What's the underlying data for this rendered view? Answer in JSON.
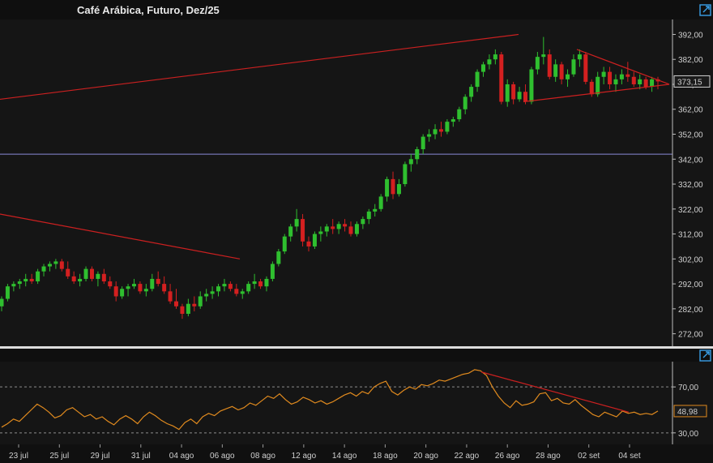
{
  "header": {
    "title": "Café Arábica, Futuro, Dez/25"
  },
  "colors": {
    "background": "#151515",
    "up": "#2fbf2f",
    "down": "#d42020",
    "trendline": "#cc2020",
    "hline": "#8a8ad8",
    "rsi": "#e08a1e",
    "label_box_rsi": "#e08a1e",
    "accent_icon": "#3aa0e8"
  },
  "chart_data": [
    {
      "type": "candlestick",
      "title": "Café Arábica, Futuro, Dez/25",
      "ylim": [
        267,
        398
      ],
      "yticks": [
        "392,00",
        "382,00",
        "372,00",
        "362,00",
        "352,00",
        "342,00",
        "332,00",
        "322,00",
        "312,00",
        "302,00",
        "292,00",
        "282,00",
        "272,00"
      ],
      "last_price_label": "373,15",
      "horizontal_line": 344.0,
      "x_labels": [
        "23 jul",
        "25 jul",
        "29 jul",
        "31 jul",
        "04 ago",
        "06 ago",
        "08 ago",
        "12 ago",
        "14 ago",
        "18 ago",
        "20 ago",
        "22 ago",
        "26 ago",
        "28 ago",
        "02 set",
        "04 set"
      ],
      "candles": [
        [
          283,
          287,
          281,
          286
        ],
        [
          286,
          292,
          285,
          291
        ],
        [
          291,
          293,
          289,
          292
        ],
        [
          292,
          294,
          290,
          293
        ],
        [
          293,
          296,
          291,
          294
        ],
        [
          294,
          296,
          292,
          293
        ],
        [
          293,
          298,
          292,
          297
        ],
        [
          297,
          300,
          295,
          299
        ],
        [
          299,
          301,
          297,
          300
        ],
        [
          300,
          302,
          298,
          301
        ],
        [
          301,
          302,
          297,
          298
        ],
        [
          298,
          301,
          294,
          295
        ],
        [
          295,
          297,
          292,
          293
        ],
        [
          293,
          296,
          291,
          294
        ],
        [
          294,
          299,
          293,
          298
        ],
        [
          298,
          299,
          293,
          294
        ],
        [
          294,
          297,
          291,
          296
        ],
        [
          296,
          298,
          292,
          293
        ],
        [
          293,
          295,
          290,
          291
        ],
        [
          291,
          293,
          285,
          287
        ],
        [
          287,
          291,
          286,
          290
        ],
        [
          290,
          292,
          287,
          291
        ],
        [
          291,
          294,
          290,
          292
        ],
        [
          292,
          293,
          288,
          289
        ],
        [
          289,
          292,
          287,
          290
        ],
        [
          290,
          296,
          289,
          294
        ],
        [
          294,
          297,
          291,
          292
        ],
        [
          292,
          295,
          288,
          289
        ],
        [
          289,
          292,
          284,
          285
        ],
        [
          285,
          290,
          282,
          283
        ],
        [
          283,
          284,
          278,
          280
        ],
        [
          280,
          286,
          279,
          284
        ],
        [
          284,
          287,
          281,
          283
        ],
        [
          283,
          289,
          282,
          287
        ],
        [
          287,
          290,
          285,
          288
        ],
        [
          288,
          291,
          286,
          289
        ],
        [
          289,
          292,
          287,
          291
        ],
        [
          291,
          294,
          289,
          292
        ],
        [
          292,
          293,
          289,
          290
        ],
        [
          290,
          292,
          287,
          288
        ],
        [
          288,
          290,
          286,
          289
        ],
        [
          289,
          293,
          288,
          292
        ],
        [
          292,
          296,
          290,
          293
        ],
        [
          293,
          294,
          290,
          291
        ],
        [
          291,
          295,
          289,
          294
        ],
        [
          294,
          301,
          293,
          300
        ],
        [
          300,
          306,
          299,
          305
        ],
        [
          305,
          312,
          304,
          311
        ],
        [
          311,
          316,
          309,
          315
        ],
        [
          315,
          322,
          313,
          318
        ],
        [
          318,
          320,
          307,
          309
        ],
        [
          309,
          311,
          305,
          307
        ],
        [
          307,
          313,
          306,
          312
        ],
        [
          312,
          315,
          309,
          313
        ],
        [
          313,
          316,
          311,
          315
        ],
        [
          315,
          318,
          312,
          314
        ],
        [
          314,
          317,
          312,
          316
        ],
        [
          316,
          318,
          313,
          315
        ],
        [
          315,
          317,
          311,
          312
        ],
        [
          312,
          317,
          311,
          316
        ],
        [
          316,
          319,
          314,
          318
        ],
        [
          318,
          322,
          316,
          321
        ],
        [
          321,
          324,
          319,
          322
        ],
        [
          322,
          328,
          321,
          327
        ],
        [
          327,
          335,
          325,
          334
        ],
        [
          334,
          337,
          326,
          328
        ],
        [
          328,
          334,
          327,
          332
        ],
        [
          332,
          341,
          331,
          340
        ],
        [
          340,
          344,
          337,
          342
        ],
        [
          342,
          347,
          340,
          346
        ],
        [
          346,
          352,
          344,
          351
        ],
        [
          351,
          354,
          349,
          352
        ],
        [
          352,
          356,
          350,
          354
        ],
        [
          354,
          357,
          351,
          353
        ],
        [
          353,
          358,
          352,
          357
        ],
        [
          357,
          359,
          355,
          358
        ],
        [
          358,
          363,
          357,
          362
        ],
        [
          362,
          368,
          360,
          367
        ],
        [
          367,
          372,
          365,
          371
        ],
        [
          371,
          378,
          369,
          377
        ],
        [
          377,
          381,
          375,
          380
        ],
        [
          380,
          384,
          378,
          382
        ],
        [
          382,
          386,
          380,
          384
        ],
        [
          384,
          385,
          364,
          365
        ],
        [
          365,
          374,
          363,
          372
        ],
        [
          372,
          373,
          364,
          366
        ],
        [
          366,
          371,
          365,
          369
        ],
        [
          369,
          372,
          364,
          365
        ],
        [
          365,
          379,
          364,
          378
        ],
        [
          378,
          385,
          376,
          383
        ],
        [
          383,
          391,
          380,
          384
        ],
        [
          384,
          386,
          374,
          375
        ],
        [
          375,
          382,
          373,
          380
        ],
        [
          380,
          381,
          372,
          374
        ],
        [
          374,
          378,
          371,
          376
        ],
        [
          376,
          384,
          375,
          382
        ],
        [
          382,
          386,
          379,
          384
        ],
        [
          384,
          385,
          372,
          373
        ],
        [
          373,
          374,
          367,
          368
        ],
        [
          368,
          377,
          367,
          375
        ],
        [
          375,
          379,
          372,
          377
        ],
        [
          377,
          379,
          370,
          372
        ],
        [
          372,
          376,
          369,
          374
        ],
        [
          374,
          378,
          372,
          376
        ],
        [
          376,
          381,
          373,
          375
        ],
        [
          375,
          377,
          371,
          372
        ],
        [
          372,
          376,
          370,
          374
        ],
        [
          374,
          375,
          370,
          371
        ],
        [
          371,
          375,
          369,
          374
        ],
        [
          374,
          375,
          370,
          373.15
        ]
      ],
      "trendlines": [
        [
          0,
          366,
          640,
          392
        ],
        [
          0,
          320,
          296,
          302
        ],
        [
          646,
          365,
          826,
          372
        ],
        [
          712,
          386,
          826,
          372
        ]
      ]
    },
    {
      "type": "line",
      "title": "",
      "ylim": [
        20,
        92
      ],
      "yticks": [
        "70,00",
        "30,00"
      ],
      "reference_lines": [
        70,
        30
      ],
      "last_value_label": "48,98",
      "values": [
        35,
        38,
        42,
        40,
        45,
        50,
        55,
        52,
        48,
        43,
        45,
        50,
        52,
        48,
        44,
        46,
        42,
        44,
        40,
        37,
        42,
        45,
        42,
        38,
        44,
        48,
        45,
        41,
        38,
        36,
        33,
        39,
        42,
        38,
        44,
        47,
        45,
        49,
        51,
        53,
        50,
        52,
        56,
        54,
        58,
        62,
        60,
        64,
        59,
        55,
        57,
        61,
        59,
        56,
        58,
        55,
        57,
        60,
        63,
        65,
        62,
        66,
        64,
        70,
        73,
        75,
        66,
        63,
        67,
        70,
        68,
        72,
        71,
        73,
        76,
        75,
        77,
        79,
        81,
        82,
        85,
        84,
        80,
        70,
        62,
        56,
        52,
        58,
        54,
        55,
        57,
        64,
        65,
        58,
        60,
        56,
        55,
        59,
        54,
        50,
        46,
        44,
        48,
        46,
        44,
        49,
        47,
        48,
        46,
        47,
        46,
        48.98
      ],
      "trendlines": [
        [
          594,
          83,
          776,
          48
        ]
      ]
    }
  ]
}
